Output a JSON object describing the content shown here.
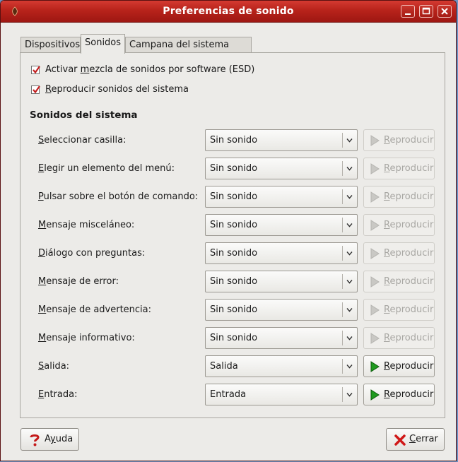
{
  "window": {
    "title": "Preferencias de sonido",
    "controls": [
      "minimize-icon",
      "maximize-icon",
      "close-icon"
    ]
  },
  "tabs": [
    {
      "label": "Dispositivos",
      "active": false
    },
    {
      "label": "Sonidos",
      "active": true
    },
    {
      "label": "Campana del sistema",
      "active": false
    }
  ],
  "options": [
    {
      "mnemonic": "",
      "pre": "Activar ",
      "key": "m",
      "rest": "ezcla de sonidos por software (ESD)",
      "checked": true
    },
    {
      "mnemonic": "",
      "pre": "",
      "key": "R",
      "rest": "eproducir sonidos del sistema",
      "checked": true
    }
  ],
  "section_title": "Sonidos del sistema",
  "sounds": [
    {
      "key": "S",
      "rest": "eleccionar casilla:",
      "value": "Sin sonido",
      "play_enabled": false
    },
    {
      "key": "E",
      "rest": "legir un elemento del menú:",
      "value": "Sin sonido",
      "play_enabled": false
    },
    {
      "key": "P",
      "rest": "ulsar sobre el botón de comando:",
      "value": "Sin sonido",
      "play_enabled": false
    },
    {
      "key": "M",
      "rest": "ensaje misceláneo:",
      "value": "Sin sonido",
      "play_enabled": false
    },
    {
      "key": "D",
      "rest": "iálogo con preguntas:",
      "value": "Sin sonido",
      "play_enabled": false
    },
    {
      "key": "M",
      "rest": "ensaje de error:",
      "value": "Sin sonido",
      "play_enabled": false
    },
    {
      "key": "M",
      "rest": "ensaje de advertencia:",
      "value": "Sin sonido",
      "play_enabled": false
    },
    {
      "key": "M",
      "rest": "ensaje informativo:",
      "value": "Sin sonido",
      "play_enabled": false
    },
    {
      "key": "S",
      "rest": "alida:",
      "value": "Salida",
      "play_enabled": true
    },
    {
      "key": "E",
      "rest": "ntrada:",
      "value": "Entrada",
      "play_enabled": true
    }
  ],
  "play_button": {
    "key": "R",
    "rest": "eproducir"
  },
  "footer": {
    "help": {
      "pre": "A",
      "key": "y",
      "rest": "uda",
      "icon": "help-icon"
    },
    "close": {
      "pre": "",
      "key": "C",
      "rest": "errar",
      "icon": "close-x-icon"
    }
  },
  "colors": {
    "titlebar": "#b8231b",
    "check": "#c21f1f",
    "play_enabled": "#1f9a1f",
    "close_icon": "#d01818"
  }
}
